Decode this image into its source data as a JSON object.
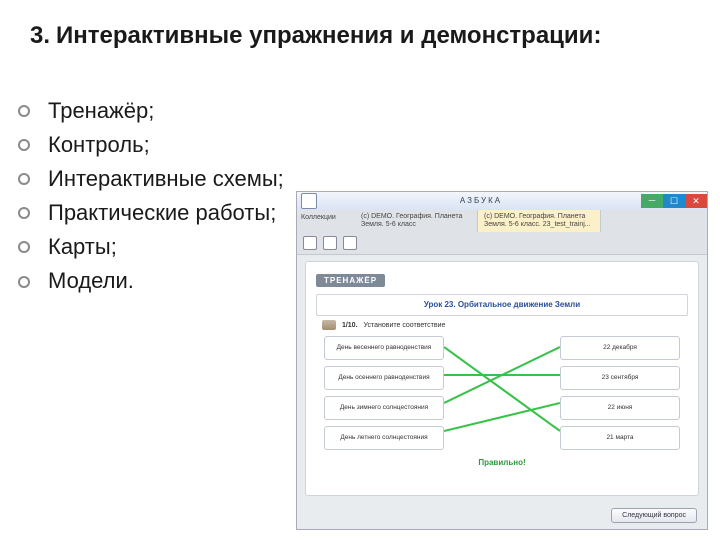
{
  "heading": {
    "number": "3.",
    "text": "Интерактивные упражнения и демонстрации:"
  },
  "bullets": [
    "Тренажёр;",
    "Контроль;",
    "Интерактивные схемы;",
    "Практические работы;",
    "Карты;",
    "Модели."
  ],
  "app": {
    "window_title": "АЗБУКА",
    "crumb_home": "Коллекции",
    "crumbs": [
      "(с) DEMO. География. Планета Земля. 5-6 класс",
      "(с) DEMO. География. Планета Земля. 5-6 класс. 23_test_trainj..."
    ],
    "chip": "ТРЕНАЖЁР",
    "lesson_title": "Урок 23. Орбитальное движение Земли",
    "prompt_num": "1/10.",
    "prompt_text": "Установите соответствие",
    "left_options": [
      "День весеннего равноденствия",
      "День осеннего равноденствия",
      "День зимнего солнцестояния",
      "День летнего солнцестояния"
    ],
    "right_options": [
      "22 декабря",
      "23 сентября",
      "22 июня",
      "21 марта"
    ],
    "feedback": "Правильно!",
    "next_label": "Следующий вопрос",
    "connections": [
      [
        0,
        3
      ],
      [
        1,
        1
      ],
      [
        2,
        0
      ],
      [
        3,
        2
      ]
    ],
    "line_color": "#39c24a"
  }
}
